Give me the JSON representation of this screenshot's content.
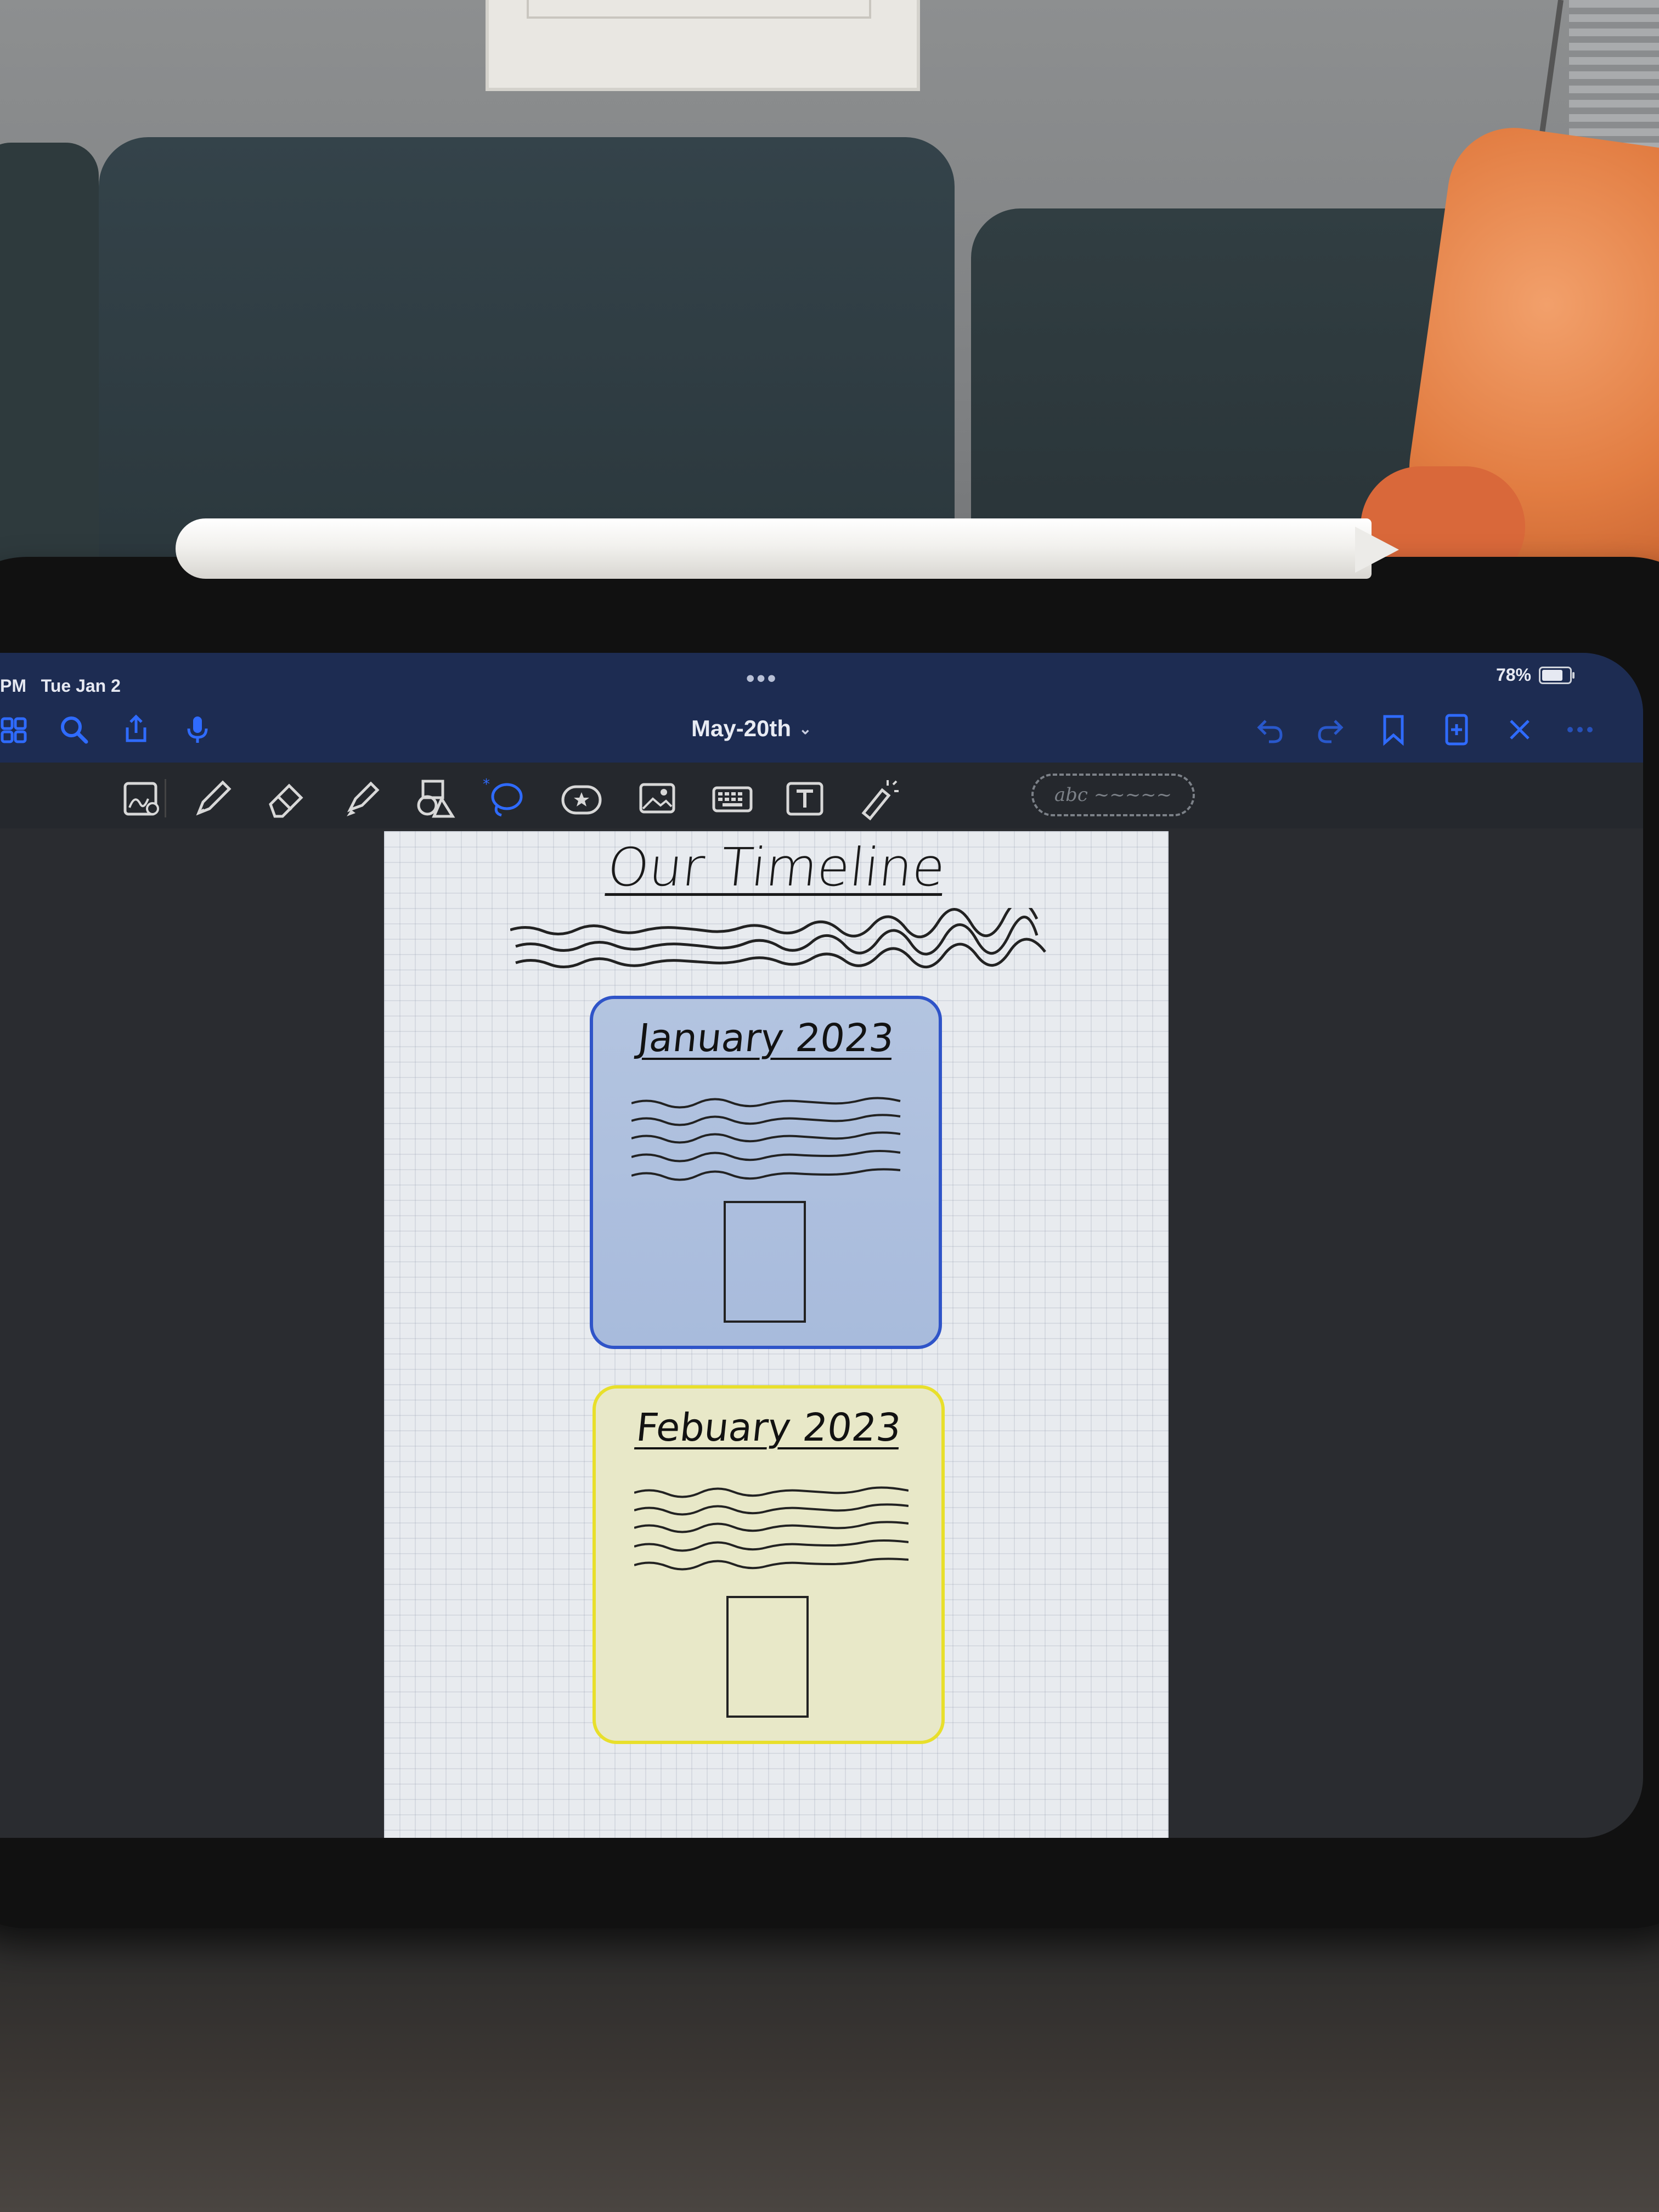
{
  "status_bar": {
    "time": "PM",
    "date": "Tue Jan 2",
    "battery": "78%",
    "battery_level": 0.78
  },
  "nav": {
    "document_title": "May-20th",
    "icons": [
      "grid-icon",
      "search-icon",
      "share-icon",
      "microphone-icon",
      "undo-icon",
      "redo-icon",
      "bookmark-icon",
      "add-page-icon",
      "close-icon",
      "more-icon"
    ]
  },
  "toolbar": {
    "tools": [
      "zoom-window-icon",
      "pen-icon",
      "eraser-icon",
      "highlighter-icon",
      "shapes-icon",
      "lasso-icon",
      "sticker-icon",
      "image-icon",
      "keyboard-icon",
      "text-box-icon",
      "laser-pointer-icon"
    ],
    "handwriting_field": "abc ~~~~~"
  },
  "page": {
    "title": "Our Timeline",
    "cards": [
      {
        "title": "January 2023",
        "color": "#2f54c8"
      },
      {
        "title": "Febuary 2023",
        "color": "#e8df2b"
      }
    ]
  },
  "colors": {
    "accent": "#2f6bff",
    "nav_background": "#1d2c52"
  }
}
